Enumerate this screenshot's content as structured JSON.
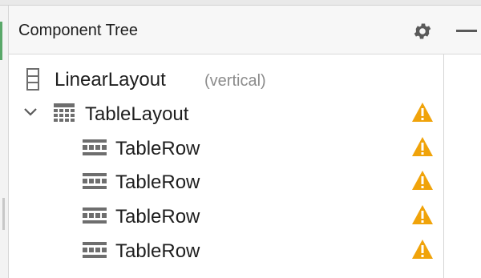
{
  "panel": {
    "title": "Component Tree"
  },
  "header_icons": [
    "gear-icon",
    "minimize-icon"
  ],
  "tree": [
    {
      "label": "LinearLayout",
      "sublabel": "(vertical)",
      "icon": "linear-layout-icon",
      "warning": false,
      "expanded": null
    },
    {
      "label": "TableLayout",
      "sublabel": "",
      "icon": "table-layout-icon",
      "warning": true,
      "expanded": true
    },
    {
      "label": "TableRow",
      "sublabel": "",
      "icon": "table-row-icon",
      "warning": true
    },
    {
      "label": "TableRow",
      "sublabel": "",
      "icon": "table-row-icon",
      "warning": true
    },
    {
      "label": "TableRow",
      "sublabel": "",
      "icon": "table-row-icon",
      "warning": true
    },
    {
      "label": "TableRow",
      "sublabel": "",
      "icon": "table-row-icon",
      "warning": true
    }
  ],
  "colors": {
    "warning": "#f0a30a",
    "icon_gray": "#6e6e6e",
    "header_bg": "#f7f7f7"
  }
}
